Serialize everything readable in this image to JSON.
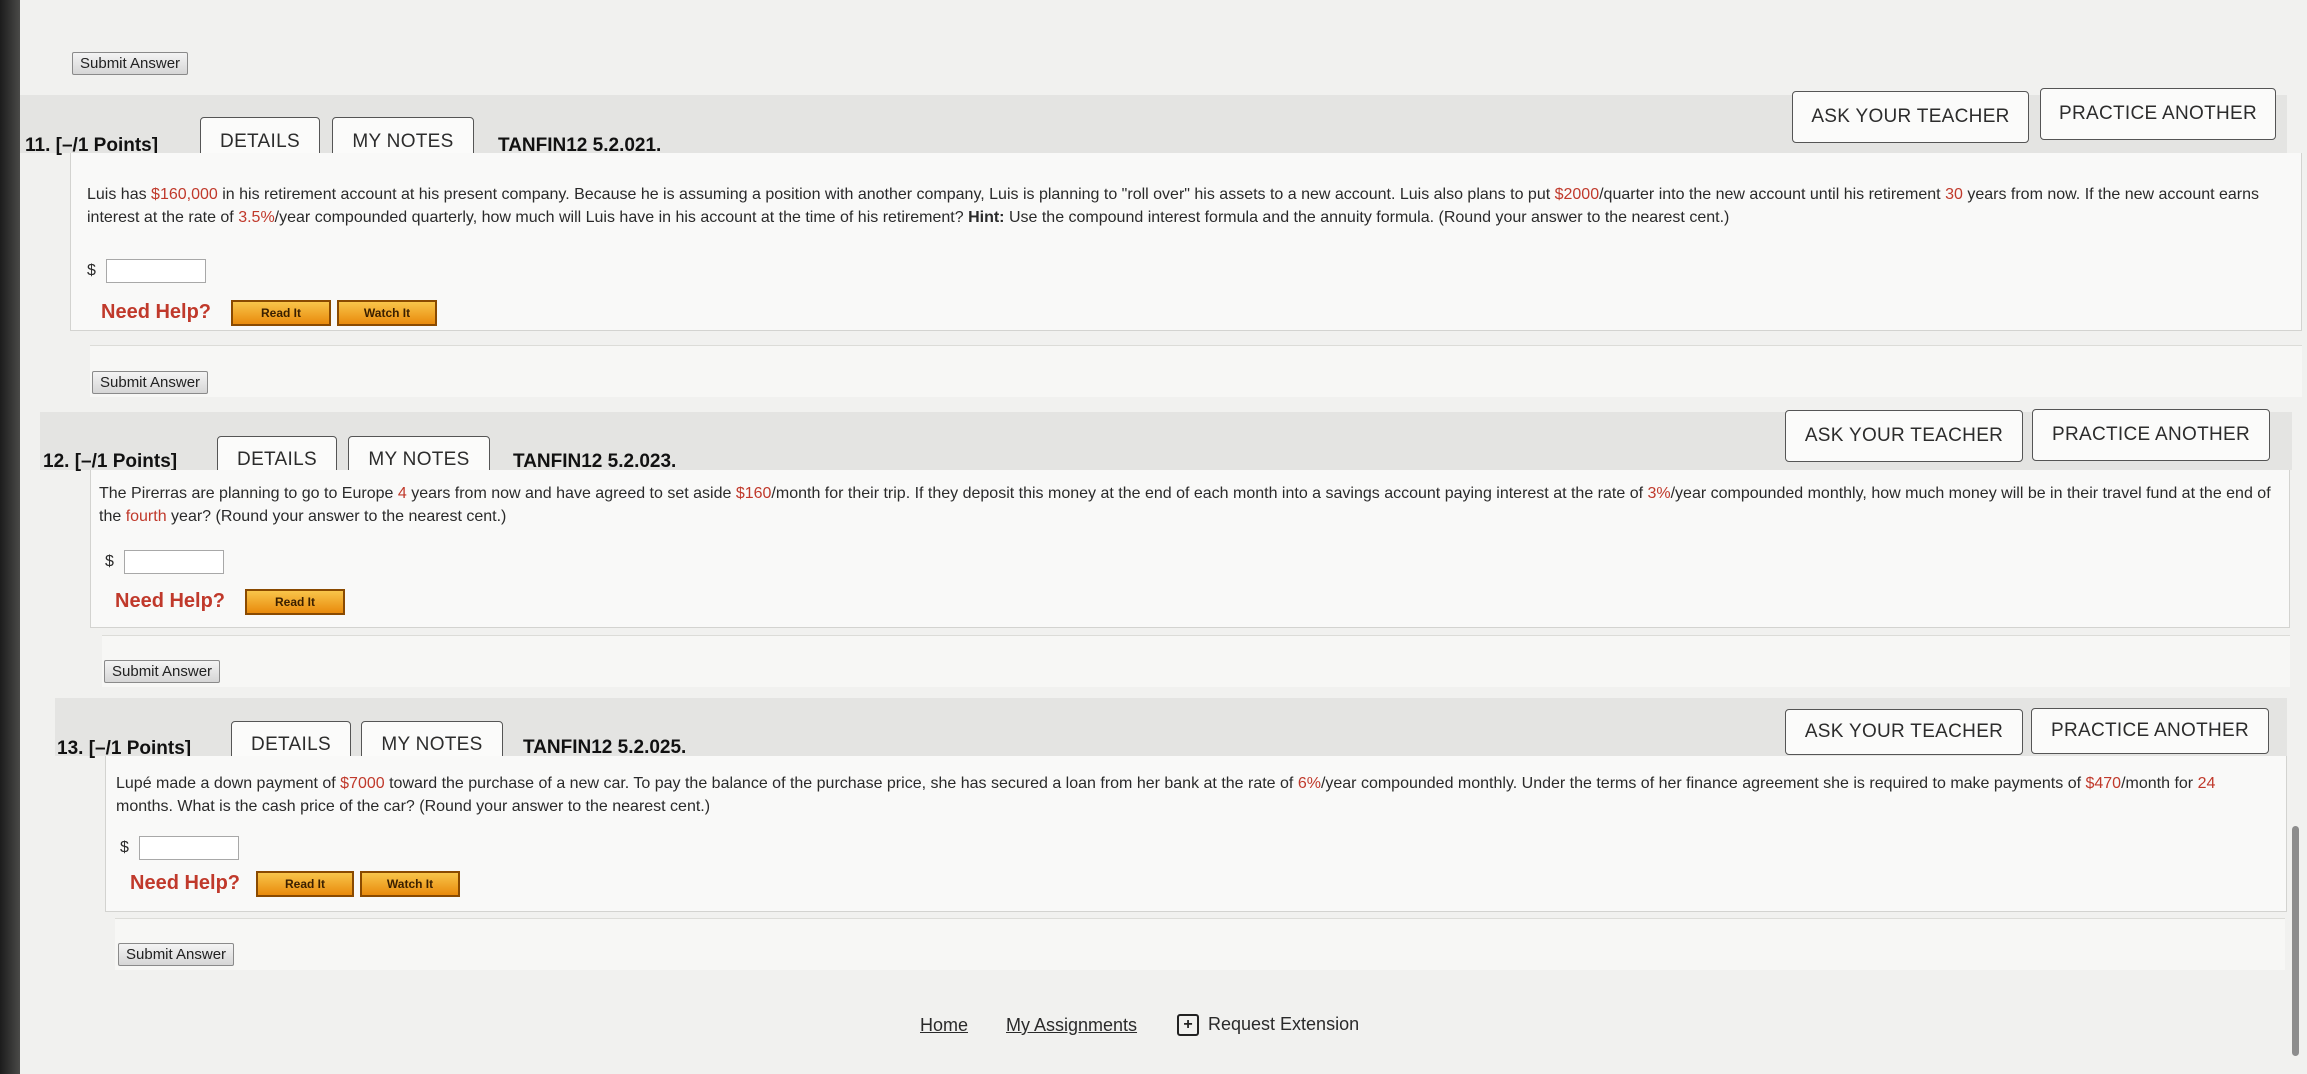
{
  "top": {
    "submit_label": "Submit Answer"
  },
  "buttons": {
    "details": "DETAILS",
    "my_notes": "MY NOTES",
    "ask_teacher": "ASK YOUR TEACHER",
    "practice_another": "PRACTICE ANOTHER",
    "submit": "Submit Answer",
    "read_it": "Read It",
    "watch_it": "Watch It",
    "need_help": "Need Help?",
    "currency": "$"
  },
  "questions": [
    {
      "number": "11.",
      "points": "[–/1 Points]",
      "code": "TANFIN12 5.2.021.",
      "text": [
        {
          "t": "Luis has "
        },
        {
          "t": "$160,000",
          "red": true
        },
        {
          "t": " in his retirement account at his present company. Because he is assuming a position with another company, Luis is planning to \"roll over\" his assets to a new account. Luis also plans to put "
        },
        {
          "t": "$2000",
          "red": true
        },
        {
          "t": "/quarter into the new account until his retirement "
        },
        {
          "t": "30",
          "red": true
        },
        {
          "t": " years from now. If the new account earns interest at the rate of "
        },
        {
          "t": "3.5%",
          "red": true
        },
        {
          "t": "/year compounded quarterly, how much will Luis have in his account at the time of his retirement? "
        },
        {
          "t": "Hint:",
          "bold": true
        },
        {
          "t": " Use the compound interest formula and the annuity formula. (Round your answer to the nearest cent.)"
        }
      ]
    },
    {
      "number": "12.",
      "points": "[–/1 Points]",
      "code": "TANFIN12 5.2.023.",
      "text": [
        {
          "t": "The Pirerras are planning to go to Europe "
        },
        {
          "t": "4",
          "red": true
        },
        {
          "t": " years from now and have agreed to set aside "
        },
        {
          "t": "$160",
          "red": true
        },
        {
          "t": "/month for their trip. If they deposit this money at the end of each month into a savings account paying interest at the rate of "
        },
        {
          "t": "3%",
          "red": true
        },
        {
          "t": "/year compounded monthly, how much money will be in their travel fund at the end of the "
        },
        {
          "t": "fourth",
          "red": true
        },
        {
          "t": " year? (Round your answer to the nearest cent.)"
        }
      ]
    },
    {
      "number": "13.",
      "points": "[–/1 Points]",
      "code": "TANFIN12 5.2.025.",
      "text": [
        {
          "t": "Lupé made a down payment of "
        },
        {
          "t": "$7000",
          "red": true
        },
        {
          "t": " toward the purchase of a new car. To pay the balance of the purchase price, she has secured a loan from her bank at the rate of "
        },
        {
          "t": "6%",
          "red": true
        },
        {
          "t": "/year compounded monthly. Under the terms of her finance agreement she is required to make payments of "
        },
        {
          "t": "$470",
          "red": true
        },
        {
          "t": "/month for "
        },
        {
          "t": "24",
          "red": true
        },
        {
          "t": " months. What is the cash price of the car? (Round your answer to the nearest cent.)"
        }
      ]
    }
  ],
  "footer": {
    "home": "Home",
    "my_assignments": "My Assignments",
    "request_extension": "Request Extension",
    "extension_icon_glyph": "+",
    "extension_icon": "calendar-plus-icon"
  }
}
